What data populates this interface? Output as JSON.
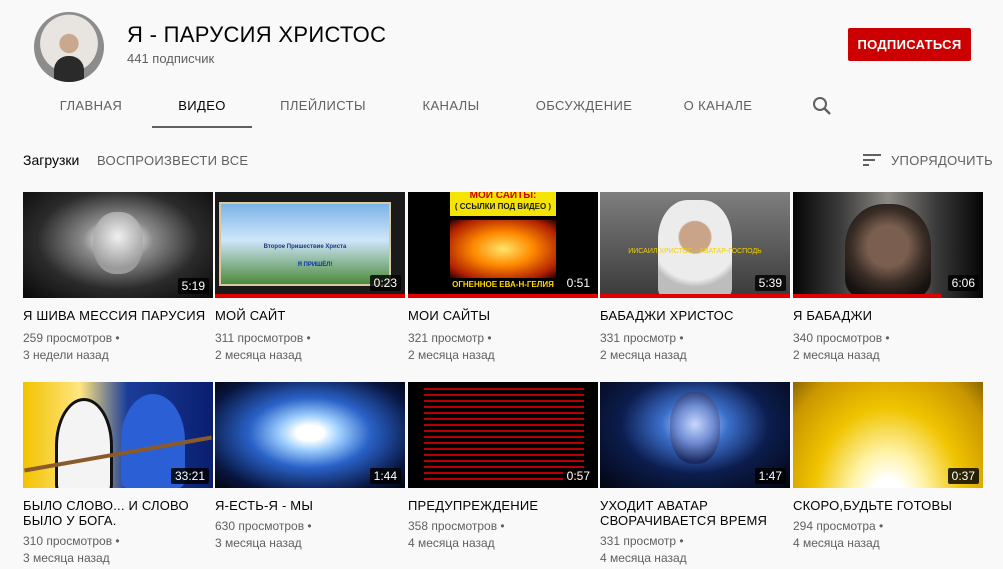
{
  "channel": {
    "title": "Я - ПАРУСИЯ ХРИСТОС",
    "subscribers": "441 подписчик",
    "subscribe_label": "ПОДПИСАТЬСЯ"
  },
  "tabs": [
    {
      "label": "ГЛАВНАЯ"
    },
    {
      "label": "ВИДЕО"
    },
    {
      "label": "ПЛЕЙЛИСТЫ"
    },
    {
      "label": "КАНАЛЫ"
    },
    {
      "label": "ОБСУЖДЕНИЕ"
    },
    {
      "label": "О КАНАЛЕ"
    }
  ],
  "toolbar": {
    "uploads": "Загрузки",
    "play_all": "ВОСПРОИЗВЕСТИ ВСЕ",
    "sort": "УПОРЯДОЧИТЬ"
  },
  "colors": {
    "accent_red": "#cc0000",
    "progress_red": "#e00000"
  },
  "videos": [
    {
      "title": "Я ШИВА МЕССИЯ ПАРУСИЯ",
      "views": "259 просмотров •",
      "age": "3 недели назад",
      "duration": "5:19",
      "watched": false
    },
    {
      "title": "МОЙ САЙТ",
      "views": "311 просмотров •",
      "age": "2 месяца назад",
      "duration": "0:23",
      "watched": true,
      "thumb_caption": "Второе Пришествие Христа",
      "thumb_caption2": "Я ПРИШЁЛ!"
    },
    {
      "title": "МОИ САЙТЫ",
      "views": "321 просмотр •",
      "age": "2 месяца назад",
      "duration": "0:51",
      "watched": true,
      "thumb_caption": "МОИ САЙТЫ:",
      "thumb_caption2": "( ССЫЛКИ ПОД ВИДЕО )",
      "thumb_caption3": "ОГНЕННОЕ ЕВА-Н-ГЕЛИЯ"
    },
    {
      "title": "БАБАДЖИ ХРИСТОС",
      "views": "331 просмотр •",
      "age": "2 месяца назад",
      "duration": "5:39",
      "watched": true,
      "thumb_caption": "ИИСАИЛ ХРИСТОС - АВАТАР-ГОСПОДЬ"
    },
    {
      "title": "Я БАБАДЖИ",
      "views": "340 просмотров •",
      "age": "2 месяца назад",
      "duration": "6:06",
      "watched": true
    },
    {
      "title": "БЫЛО СЛОВО... И СЛОВО БЫЛО У БОГА.",
      "views": "310 просмотров •",
      "age": "3 месяца назад",
      "duration": "33:21",
      "watched": false
    },
    {
      "title": "Я-ЕСТЬ-Я - МЫ",
      "views": "630 просмотров •",
      "age": "3 месяца назад",
      "duration": "1:44",
      "watched": false
    },
    {
      "title": "ПРЕДУПРЕЖДЕНИЕ",
      "views": "358 просмотров •",
      "age": "4 месяца назад",
      "duration": "0:57",
      "watched": false
    },
    {
      "title": "УХОДИТ АВАТАР СВОРАЧИВАЕТСЯ ВРЕМЯ",
      "views": "331 просмотр •",
      "age": "4 месяца назад",
      "duration": "1:47",
      "watched": false
    },
    {
      "title": "СКОРО,БУДЬТЕ ГОТОВЫ",
      "views": "294 просмотра •",
      "age": "4 месяца назад",
      "duration": "0:37",
      "watched": false
    }
  ]
}
